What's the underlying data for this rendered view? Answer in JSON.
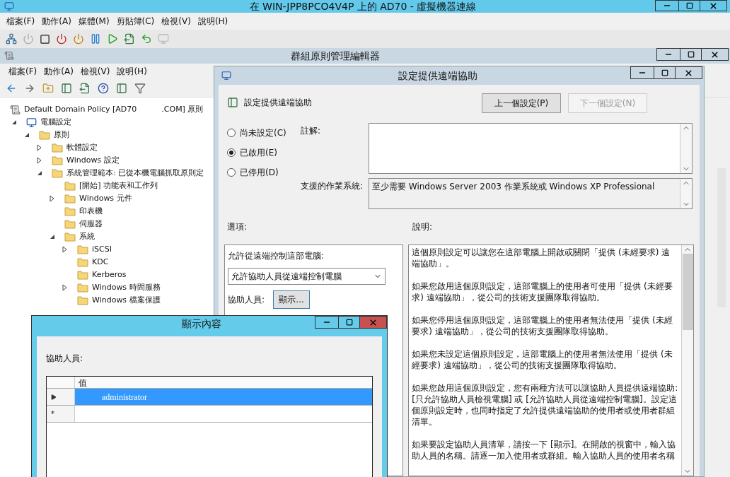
{
  "vm_window": {
    "title": "在 WIN-JPP8PCO4V4P 上的 AD70 - 虛擬機器連線",
    "menu": [
      "檔案(F)",
      "動作(A)",
      "媒體(M)",
      "剪貼簿(C)",
      "檢視(V)",
      "說明(H)"
    ]
  },
  "gpm_window": {
    "title": "群組原則管理編輯器",
    "menu": [
      "檔案(F)",
      "動作(A)",
      "檢視(V)",
      "說明(H)"
    ],
    "tree": [
      {
        "label": "Default Domain Policy [AD70",
        "label_2": ".COM] 原則",
        "kind": "policy",
        "children": [
          {
            "label": "電腦設定",
            "kind": "computer",
            "expanded": true,
            "children": [
              {
                "label": "原則",
                "kind": "folder",
                "expanded": true,
                "children": [
                  {
                    "label": "軟體設定",
                    "kind": "folder",
                    "expanded": false
                  },
                  {
                    "label": "Windows 設定",
                    "kind": "folder",
                    "expanded": false
                  },
                  {
                    "label": "系統管理範本: 已從本機電腦抓取原則定",
                    "kind": "folder",
                    "expanded": true,
                    "children": [
                      {
                        "label": "[開始] 功能表和工作列",
                        "kind": "folder"
                      },
                      {
                        "label": "Windows 元件",
                        "kind": "folder",
                        "expanded": false
                      },
                      {
                        "label": "印表機",
                        "kind": "folder"
                      },
                      {
                        "label": "伺服器",
                        "kind": "folder"
                      },
                      {
                        "label": "系統",
                        "kind": "folder",
                        "expanded": true,
                        "children": [
                          {
                            "label": "iSCSI",
                            "kind": "folder",
                            "expanded": false
                          },
                          {
                            "label": "KDC",
                            "kind": "folder"
                          },
                          {
                            "label": "Kerberos",
                            "kind": "folder"
                          },
                          {
                            "label": "Windows 時間服務",
                            "kind": "folder",
                            "expanded": false
                          },
                          {
                            "label": "Windows 檔案保護",
                            "kind": "folder"
                          }
                        ]
                      }
                    ]
                  }
                ]
              }
            ]
          }
        ]
      }
    ]
  },
  "policy_dialog": {
    "title": "設定提供遠端協助",
    "setting_name": "設定提供遠端協助",
    "buttons": [
      {
        "label": "上一個設定(P)",
        "disabled": false
      },
      {
        "label": "下一個設定(N)",
        "disabled": true
      }
    ],
    "states": [
      {
        "label": "尚未設定(C)",
        "selected": false
      },
      {
        "label": "已啟用(E)",
        "selected": true
      },
      {
        "label": "已停用(D)",
        "selected": false
      }
    ],
    "comment_label": "註解:",
    "supported_label": "支援的作業系統:",
    "supported_text": "至少需要 Windows Server 2003 作業系統或 Windows XP Professional",
    "options_label": "選項:",
    "help_label": "說明:",
    "options": {
      "prompt": "允許從遠端控制這部電腦:",
      "dropdown_value": "允許協助人員從遠端控制電腦",
      "helpers_label": "協助人員:",
      "show_button": "顯示..."
    },
    "help_paragraphs": [
      "這個原則設定可以讓您在這部電腦上開啟或關閉「提供 (未經要求) 遠端協助」。",
      "如果您啟用這個原則設定，這部電腦上的使用者可使用「提供 (未經要求) 遠端協助」，從公司的技術支援團隊取得協助。",
      "如果您停用這個原則設定，這部電腦上的使用者無法使用「提供 (未經要求) 遠端協助」，從公司的技術支援團隊取得協助。",
      "如果您未設定這個原則設定，這部電腦上的使用者無法使用「提供 (未經要求) 遠端協助」，從公司的技術支援團隊取得協助。",
      "如果您啟用這個原則設定，您有兩種方法可以讓協助人員提供遠端協助: [只允許協助人員檢視電腦] 或 [允許協助人員從遠端控制電腦]。設定這個原則設定時，也同時指定了允許提供遠端協助的使用者或使用者群組清單。",
      "如果要設定協助人員清單，請按一下 [顯示]。在開啟的視窗中，輸入協助人員的名稱。請逐一加入使用者或群組。輸入協助人員的使用者名稱"
    ]
  },
  "show_dialog": {
    "title": "顯示內容",
    "label": "協助人員:",
    "column": "值",
    "rows": [
      {
        "kind": "current",
        "value": "administrator",
        "selected": true
      },
      {
        "kind": "new",
        "marker": "*",
        "selected": false
      }
    ]
  }
}
